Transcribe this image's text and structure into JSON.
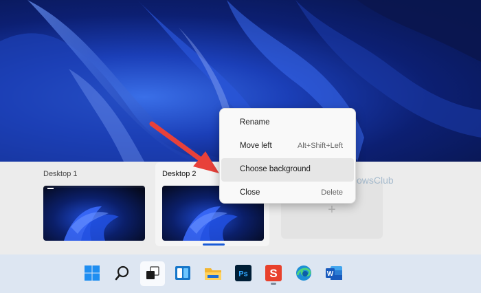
{
  "task_view": {
    "desktops": [
      {
        "label": "Desktop 1"
      },
      {
        "label": "Desktop 2"
      }
    ],
    "new_desktop_symbol": "+"
  },
  "context_menu": {
    "items": [
      {
        "label": "Rename",
        "shortcut": ""
      },
      {
        "label": "Move left",
        "shortcut": "Alt+Shift+Left"
      },
      {
        "label": "Choose background",
        "shortcut": "",
        "hovered": true
      },
      {
        "label": "Close",
        "shortcut": "Delete"
      }
    ]
  },
  "watermark": {
    "text": "TheWindowsClub"
  },
  "taskbar": {
    "icons": [
      "windows-start-icon",
      "search-icon",
      "task-view-icon",
      "widgets-icon",
      "file-explorer-icon",
      "photoshop-icon",
      "wps-office-icon",
      "edge-icon",
      "word-icon"
    ],
    "photoshop_text": "Ps",
    "wps_text": "S",
    "word_text": "W"
  },
  "colors": {
    "accent": "#1a5bd6",
    "arrow": "#e8413a",
    "menu_hover": "#e6e6e6"
  }
}
